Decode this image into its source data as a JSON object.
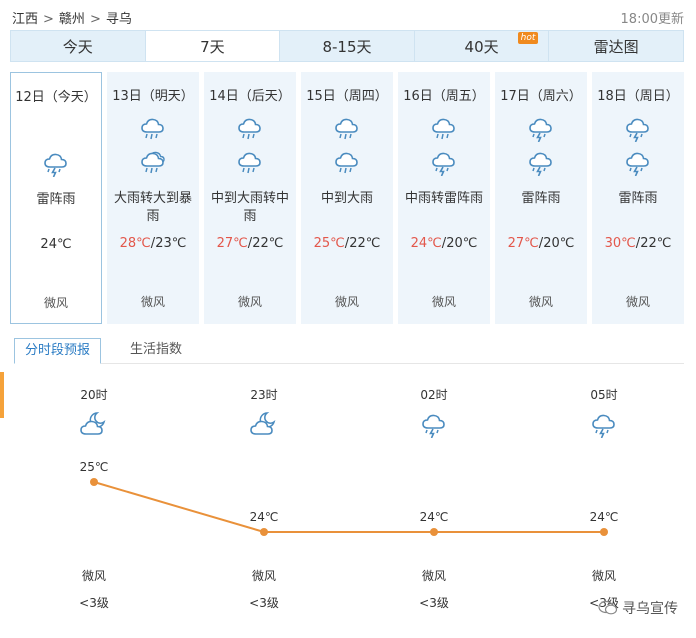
{
  "breadcrumb": {
    "province": "江西",
    "sep1": ">",
    "city": "赣州",
    "sep2": ">",
    "county": "寻乌"
  },
  "updated": "18:00更新",
  "tabs": [
    {
      "label": "今天"
    },
    {
      "label": "7天"
    },
    {
      "label": "8-15天"
    },
    {
      "label": "40天",
      "badge": "hot"
    },
    {
      "label": "雷达图"
    }
  ],
  "days": [
    {
      "date": "12日（今天）",
      "icon_primary": "thunderstorm-icon",
      "description": "雷阵雨",
      "high": "",
      "low": "24℃",
      "wind": "微风"
    },
    {
      "date": "13日（明天）",
      "icon_primary": "heavy-rain-icon",
      "icon_secondary": "rainstorm-icon",
      "description": "大雨转大到暴雨",
      "high": "28℃",
      "low": "23℃",
      "wind": "微风"
    },
    {
      "date": "14日（后天）",
      "icon_primary": "rain-icon",
      "icon_secondary": "rain-icon",
      "description": "中到大雨转中雨",
      "high": "27℃",
      "low": "22℃",
      "wind": "微风"
    },
    {
      "date": "15日（周四）",
      "icon_primary": "rain-icon",
      "icon_secondary": "rain-icon",
      "description": "中到大雨",
      "high": "25℃",
      "low": "22℃",
      "wind": "微风"
    },
    {
      "date": "16日（周五）",
      "icon_primary": "rain-icon",
      "icon_secondary": "thunderstorm-icon",
      "description": "中雨转雷阵雨",
      "high": "24℃",
      "low": "20℃",
      "wind": "微风"
    },
    {
      "date": "17日（周六）",
      "icon_primary": "thunderstorm-icon",
      "icon_secondary": "thunderstorm-icon",
      "description": "雷阵雨",
      "high": "27℃",
      "low": "20℃",
      "wind": "微风"
    },
    {
      "date": "18日（周日）",
      "icon_primary": "thunderstorm-icon",
      "icon_secondary": "thunderstorm-icon",
      "description": "雷阵雨",
      "high": "30℃",
      "low": "22℃",
      "wind": "微风"
    }
  ],
  "subtabs": {
    "active": "分时段预报",
    "second": "生活指数"
  },
  "hourly": [
    {
      "time": "20时",
      "icon": "night-cloudy-icon",
      "temp_label": "25℃",
      "temp": 25,
      "wind": "微风",
      "level": "<3级"
    },
    {
      "time": "23时",
      "icon": "night-cloudy-icon",
      "temp_label": "24℃",
      "temp": 24,
      "wind": "微风",
      "level": "<3级"
    },
    {
      "time": "02时",
      "icon": "thunderstorm-icon",
      "temp_label": "24℃",
      "temp": 24,
      "wind": "微风",
      "level": "<3级"
    },
    {
      "time": "05时",
      "icon": "thunderstorm-icon",
      "temp_label": "24℃",
      "temp": 24,
      "wind": "微风",
      "level": "<3级"
    }
  ],
  "colors": {
    "line": "#e9913a",
    "icon": "#4a8bbf",
    "high_temp": "#e3574b",
    "tab_bg": "#e3f0f9",
    "day_bg": "#eef5fb"
  },
  "watermark": "寻乌宣传"
}
